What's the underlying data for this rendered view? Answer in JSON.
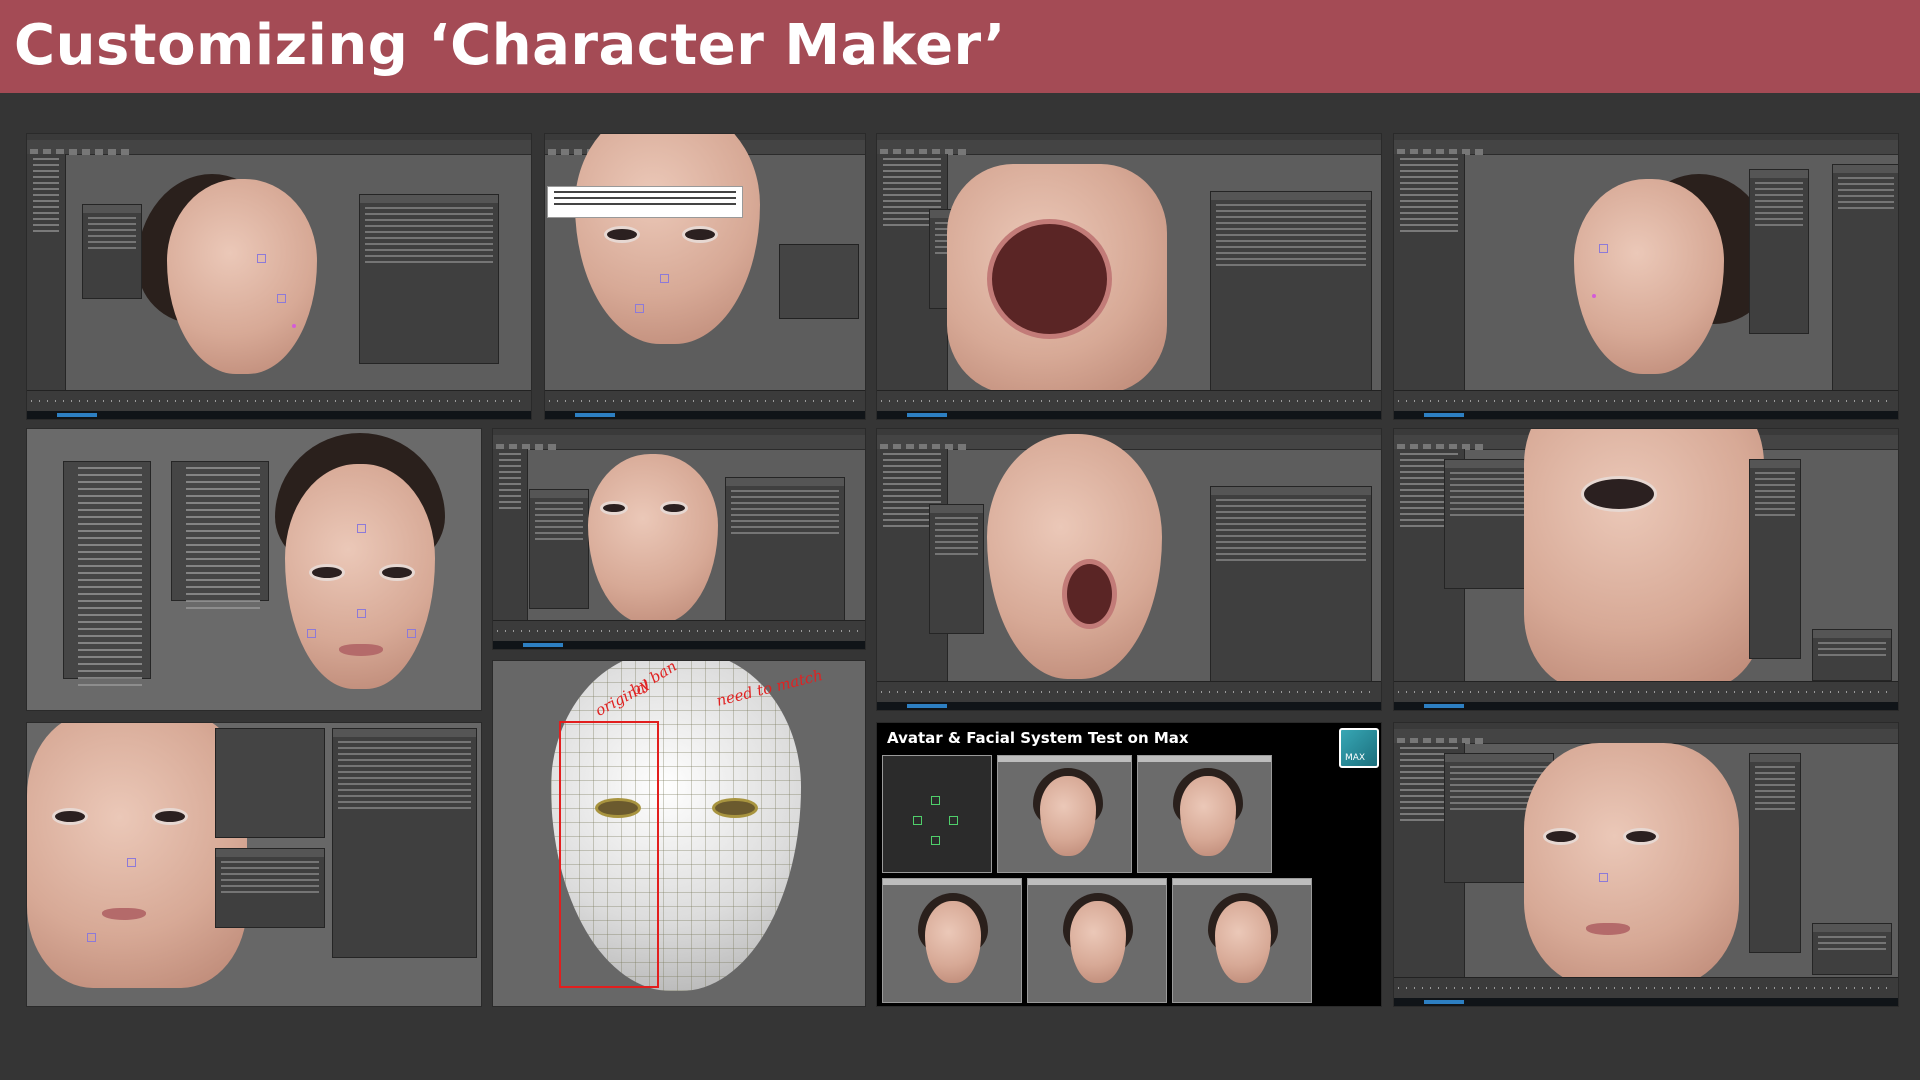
{
  "slide": {
    "title": "Customizing ‘Character Maker’",
    "title_bar_color": "#a44b55",
    "background_color": "#353535"
  },
  "max_panel": {
    "title": "Avatar & Facial System Test on Max",
    "logo_text": "MAX"
  },
  "annotations": {
    "original": "original",
    "by_ban": "by ban",
    "need_to_match": "need to match"
  }
}
